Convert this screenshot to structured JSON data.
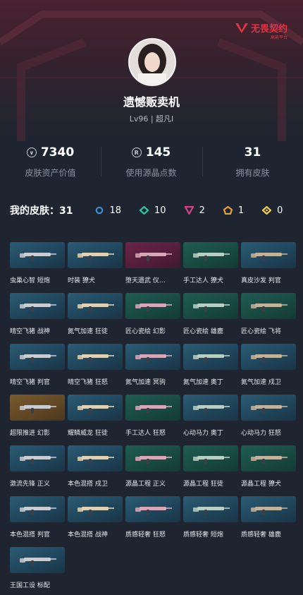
{
  "header": {
    "logo_text": "无畏契约",
    "logo_sub": "高能平台",
    "username": "遗憾贩卖机",
    "level_text": "Lv96 | 超凡I"
  },
  "stats": [
    {
      "value": "7340",
      "label": "皮肤资产价值",
      "icon": "vp-icon"
    },
    {
      "value": "145",
      "label": "使用源晶点数",
      "icon": "radianite-icon"
    },
    {
      "value": "31",
      "label": "拥有皮肤",
      "icon": ""
    }
  ],
  "skins_summary": {
    "title": "我的皮肤：31",
    "rarities": [
      {
        "name": "select",
        "count": "18",
        "color": "#3a8fd6"
      },
      {
        "name": "deluxe",
        "count": "10",
        "color": "#2bc3a0"
      },
      {
        "name": "premium",
        "count": "2",
        "color": "#d6418a"
      },
      {
        "name": "exclusive",
        "count": "1",
        "color": "#e6a23a"
      },
      {
        "name": "ultra",
        "count": "0",
        "color": "#f2d04a"
      }
    ]
  },
  "skins": [
    {
      "label": "虫巢心智 短炮",
      "bg": "blue"
    },
    {
      "label": "时装 獠犬",
      "bg": "blue"
    },
    {
      "label": "堕天遗武 仪…",
      "bg": "purple"
    },
    {
      "label": "手工达人 獠犬",
      "bg": "green"
    },
    {
      "label": "真皮沙发 判官",
      "bg": "blue"
    },
    {
      "label": "晴空飞猪 战神",
      "bg": "blue"
    },
    {
      "label": "氮气加速 狂徒",
      "bg": "blue"
    },
    {
      "label": "匠心瓷绘 幻影",
      "bg": "green"
    },
    {
      "label": "匠心瓷绘 雄鹿",
      "bg": "green"
    },
    {
      "label": "匠心瓷绘 飞将",
      "bg": "green"
    },
    {
      "label": "晴空飞猪 判官",
      "bg": "blue"
    },
    {
      "label": "晴空飞猪 狂怒",
      "bg": "blue"
    },
    {
      "label": "氮气加速 冥驹",
      "bg": "blue"
    },
    {
      "label": "氮气加速 奥丁",
      "bg": "blue"
    },
    {
      "label": "氮气加速 戍卫",
      "bg": "blue"
    },
    {
      "label": "超限推进 幻影",
      "bg": "gold"
    },
    {
      "label": "耀鳞威龙 狂徒",
      "bg": "blue"
    },
    {
      "label": "手工达人 狂怒",
      "bg": "green"
    },
    {
      "label": "心动马力 奥丁",
      "bg": "blue"
    },
    {
      "label": "心动马力 狂怒",
      "bg": "blue"
    },
    {
      "label": "激流先锋 正义",
      "bg": "blue"
    },
    {
      "label": "本色混搭 戍卫",
      "bg": "blue"
    },
    {
      "label": "源晶工程 正义",
      "bg": "green"
    },
    {
      "label": "源晶工程 狂徒",
      "bg": "green"
    },
    {
      "label": "源晶工程 獠犬",
      "bg": "green"
    },
    {
      "label": "本色混搭 判官",
      "bg": "blue"
    },
    {
      "label": "本色混搭 战神",
      "bg": "blue"
    },
    {
      "label": "质感轻奢 狂怒",
      "bg": "blue"
    },
    {
      "label": "质感轻奢 短炮",
      "bg": "blue"
    },
    {
      "label": "质感轻奢 雄鹿",
      "bg": "blue"
    },
    {
      "label": "王国工设 标配",
      "bg": "blue"
    }
  ]
}
